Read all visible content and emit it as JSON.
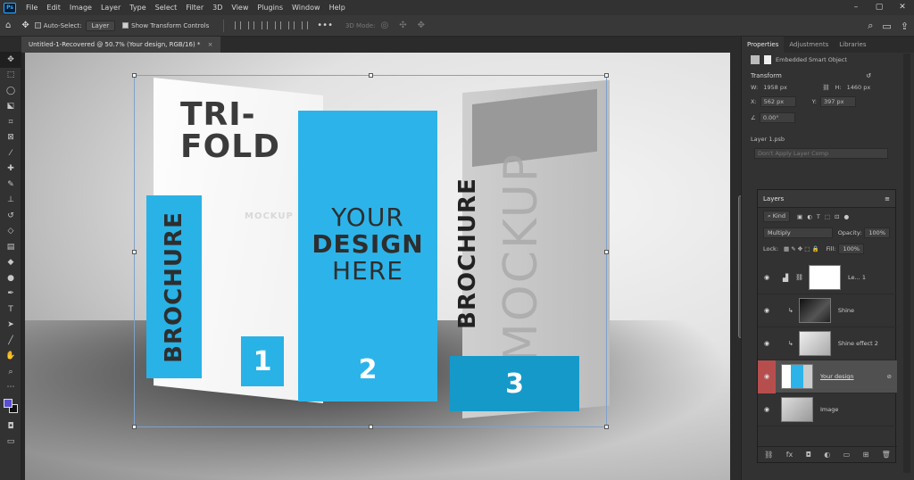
{
  "menubar": {
    "logo": "Ps",
    "items": [
      "File",
      "Edit",
      "Image",
      "Layer",
      "Type",
      "Select",
      "Filter",
      "3D",
      "View",
      "Plugins",
      "Window",
      "Help"
    ],
    "window_controls": [
      "–",
      "▢",
      "✕"
    ]
  },
  "optbar": {
    "auto_select_label": "Auto-Select:",
    "auto_select_value": "Layer",
    "transform_controls_label": "Show Transform Controls",
    "mode_3d": "3D Mode:",
    "more": "•••"
  },
  "document": {
    "tab_title": "Untitled-1-Recovered @ 50.7% (Your design, RGB/16) *",
    "close": "×"
  },
  "artwork": {
    "trifold_l1": "TRI-",
    "trifold_l2": "FOLD",
    "mockup_small": "MOCKUP",
    "brochure_left": "BROCHURE",
    "num1": "1",
    "your": "YOUR",
    "design": "DESIGN",
    "here": "HERE",
    "num2": "2",
    "brochure_right": "BROCHURE",
    "mockup_large": "MOCKUP",
    "num3": "3"
  },
  "properties": {
    "tabs": [
      "Properties",
      "Adjustments",
      "Libraries"
    ],
    "object_type": "Embedded Smart Object",
    "transform_label": "Transform",
    "w_label": "W:",
    "w_value": "1958 px",
    "h_label": "H:",
    "h_value": "1460 px",
    "x_label": "X:",
    "x_value": "562 px",
    "y_label": "Y:",
    "y_value": "397 px",
    "angle_value": "0.00°",
    "file_name": "Layer 1.psb",
    "layer_comp": "Don't Apply Layer Comp"
  },
  "layers": {
    "title": "Layers",
    "filter_kind": "Kind",
    "blend_mode": "Multiply",
    "opacity_label": "Opacity:",
    "opacity_value": "100%",
    "lock_label": "Lock:",
    "fill_label": "Fill:",
    "fill_value": "100%",
    "items": [
      {
        "name": "Le... 1",
        "selected": false
      },
      {
        "name": "Shine",
        "selected": false
      },
      {
        "name": "Shine effect 2",
        "selected": false
      },
      {
        "name": "Your design",
        "selected": true
      },
      {
        "name": "Image",
        "selected": false
      }
    ],
    "footer_icons": [
      "link-icon",
      "fx-icon",
      "mask-icon",
      "adjustment-icon",
      "group-icon",
      "new-layer-icon",
      "trash-icon"
    ],
    "footer_glyphs": [
      "⛓",
      "fx",
      "◘",
      "◐",
      "▭",
      "⊞",
      "🗑"
    ]
  },
  "colors": {
    "foreground": "#5b4fcf",
    "background": "#111111",
    "brochure_blue": "#2cb4ea",
    "brochure_blue_dark": "#1599c9",
    "selected_eye": "#b74e4e"
  }
}
